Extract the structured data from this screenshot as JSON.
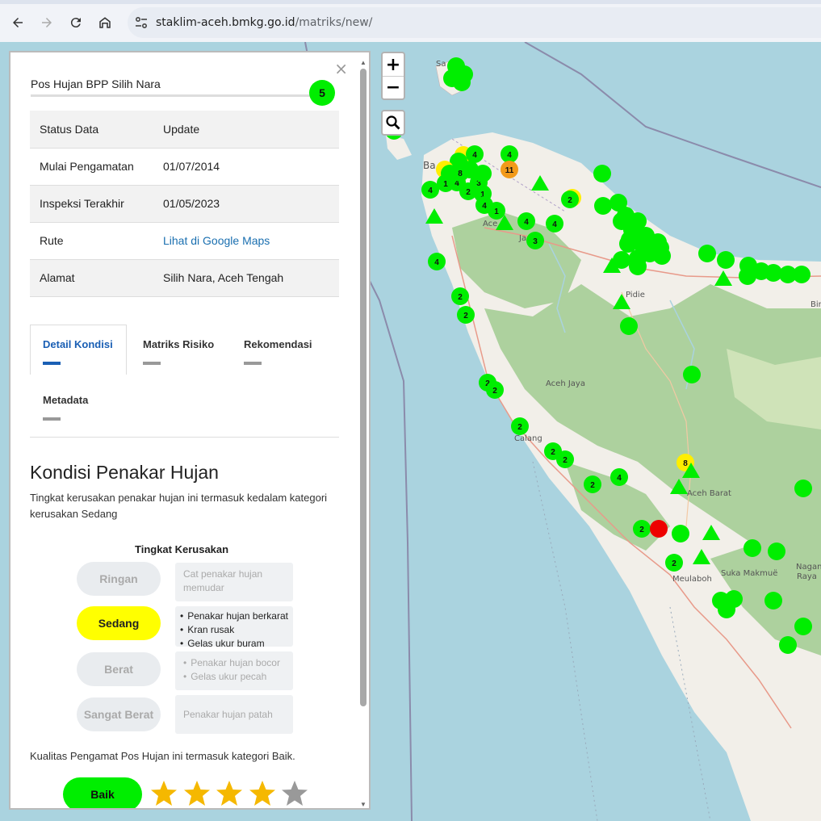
{
  "browser": {
    "url_host": "staklim-aceh.bmkg.go.id",
    "url_path": "/matriks/new/"
  },
  "map": {
    "zoom_in_label": "+",
    "zoom_out_label": "−",
    "place_labels": [
      {
        "name": "Sabang",
        "text": "Sa      g"
      },
      {
        "name": "banda-aceh",
        "text": "Ba"
      },
      {
        "name": "aceh-besar",
        "text": "Ace"
      },
      {
        "name": "jantho",
        "text": "Ja"
      },
      {
        "name": "pidie",
        "text": "Pidie"
      },
      {
        "name": "aceh-jaya",
        "text": "Aceh Jaya"
      },
      {
        "name": "calang",
        "text": "Calang"
      },
      {
        "name": "aceh-barat",
        "text": "Aceh Barat"
      },
      {
        "name": "meulaboh",
        "text": "Meulaboh"
      },
      {
        "name": "suka-makmue",
        "text": "Suka Makmuë"
      },
      {
        "name": "nagan-raya-1",
        "text": "Nagan"
      },
      {
        "name": "nagan-raya-2",
        "text": "Raya"
      },
      {
        "name": "bireuen",
        "text": "Bir"
      }
    ],
    "markers": [
      {
        "type": "circle",
        "color": "#00ee00",
        "label": ""
      },
      {
        "type": "circle",
        "color": "#ee0000",
        "label": ""
      },
      {
        "type": "circle",
        "color": "#ffee00",
        "label": "8"
      },
      {
        "type": "circle",
        "color": "#f29a1a",
        "label": "11"
      },
      {
        "type": "triangle",
        "color": "#00ee00",
        "label": ""
      }
    ],
    "cluster_labels": [
      "4",
      "4",
      "4",
      "1",
      "4",
      "3",
      "2",
      "8",
      "1",
      "4",
      "2",
      "4",
      "1",
      "4",
      "4",
      "3",
      "4",
      "2",
      "2",
      "2",
      "2",
      "2",
      "2",
      "2",
      "4",
      "8",
      "2",
      "2",
      "11"
    ]
  },
  "panel": {
    "close_label": "×",
    "station_name": "Pos Hujan BPP Silih Nara",
    "station_count": "5",
    "info_rows": [
      {
        "label": "Status Data",
        "value": "Update"
      },
      {
        "label": "Mulai Pengamatan",
        "value": "01/07/2014"
      },
      {
        "label": "Inspeksi Terakhir",
        "value": "01/05/2023"
      },
      {
        "label": "Rute",
        "value": "Lihat di Google Maps"
      },
      {
        "label": "Alamat",
        "value": "Silih Nara, Aceh Tengah"
      }
    ],
    "tabs": [
      "Detail Kondisi",
      "Matriks Risiko",
      "Rekomendasi",
      "Metadata"
    ],
    "active_tab": "Detail Kondisi",
    "section_title": "Kondisi Penakar Hujan",
    "section_desc": "Tingkat kerusakan penakar hujan ini termasuk kedalam kategori kerusakan Sedang",
    "level_title": "Tingkat Kerusakan",
    "levels": [
      {
        "label": "Ringan",
        "active": false,
        "desc": [
          "Cat penakar hujan memudar"
        ]
      },
      {
        "label": "Sedang",
        "active": true,
        "desc": [
          "Penakar hujan berkarat",
          "Kran rusak",
          "Gelas ukur buram"
        ]
      },
      {
        "label": "Berat",
        "active": false,
        "desc": [
          "Penakar hujan bocor",
          "Gelas ukur pecah"
        ]
      },
      {
        "label": "Sangat Berat",
        "active": false,
        "desc": [
          "Penakar hujan patah"
        ]
      }
    ],
    "quality_text": "Kualitas Pengamat Pos Hujan ini termasuk kategori Baik.",
    "quality_label": "Baik",
    "quality_rating": 4,
    "quality_rating_max": 5,
    "colors": {
      "green": "#00ee00",
      "yellow": "#ffff00",
      "star_on": "#f5b800",
      "star_off": "#999999",
      "link": "#1a6fb0"
    }
  }
}
